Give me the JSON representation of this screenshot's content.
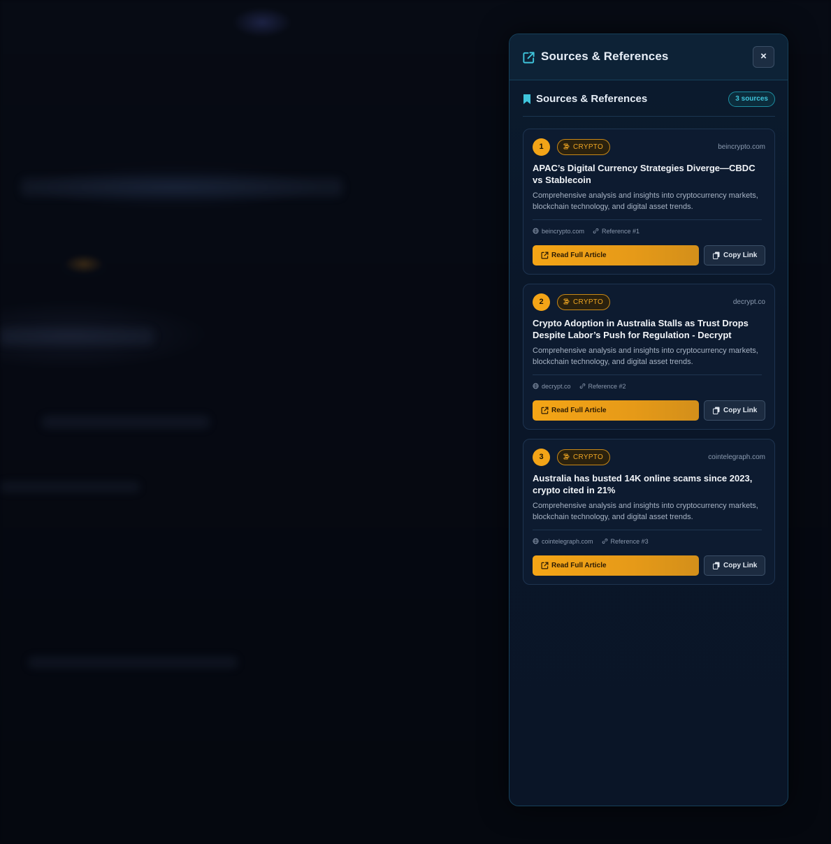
{
  "panel": {
    "title": "Sources & References",
    "close_label": "×",
    "accent": "#3fc5dc"
  },
  "section": {
    "title": "Sources & References",
    "count_badge": "3 sources"
  },
  "cards": [
    {
      "number": "1",
      "category": "CRYPTO",
      "domain": "beincrypto.com",
      "title": "APAC’s Digital Currency Strategies Diverge—CBDC vs Stablecoin",
      "description": "Comprehensive analysis and insights into cryptocurrency markets, blockchain technology, and digital asset trends.",
      "meta_domain": "beincrypto.com",
      "reference": "Reference #1",
      "read_label": "Read Full Article",
      "copy_label": "Copy Link"
    },
    {
      "number": "2",
      "category": "CRYPTO",
      "domain": "decrypt.co",
      "title": "Crypto Adoption in Australia Stalls as Trust Drops Despite Labor’s Push for Regulation - Decrypt",
      "description": "Comprehensive analysis and insights into cryptocurrency markets, blockchain technology, and digital asset trends.",
      "meta_domain": "decrypt.co",
      "reference": "Reference #2",
      "read_label": "Read Full Article",
      "copy_label": "Copy Link"
    },
    {
      "number": "3",
      "category": "CRYPTO",
      "domain": "cointelegraph.com",
      "title": "Australia has busted 14K online scams since 2023, crypto cited in 21%",
      "description": "Comprehensive analysis and insights into cryptocurrency markets, blockchain technology, and digital asset trends.",
      "meta_domain": "cointelegraph.com",
      "reference": "Reference #3",
      "read_label": "Read Full Article",
      "copy_label": "Copy Link"
    }
  ],
  "colors": {
    "brand_orange": "#f3a417",
    "panel_bg": "#0a1628",
    "badge_cyan": "#3fc5dc"
  }
}
